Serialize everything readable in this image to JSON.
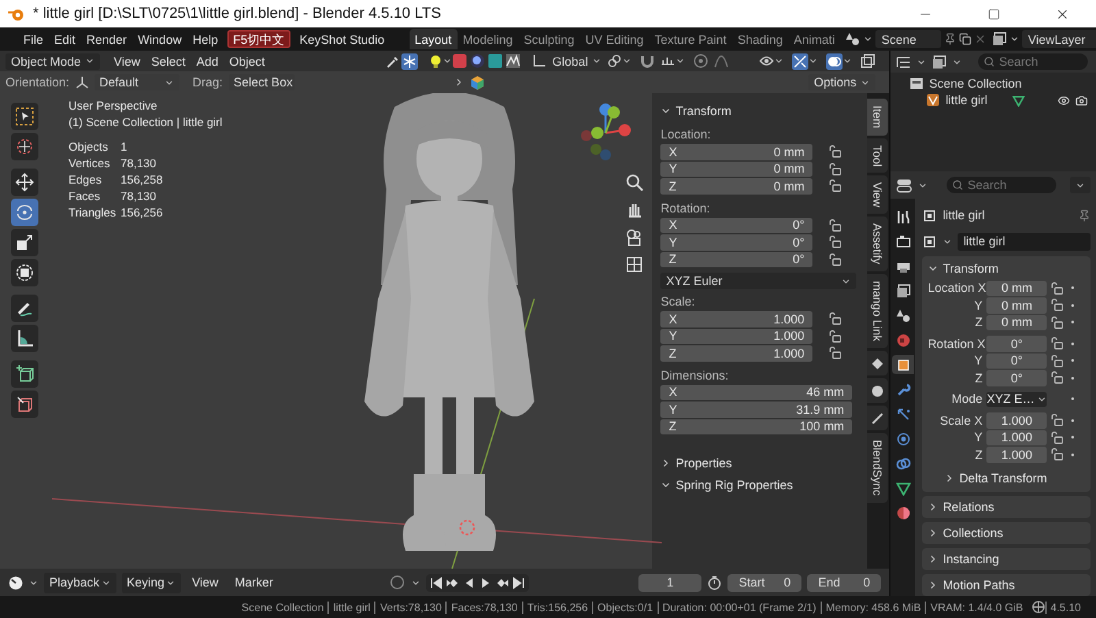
{
  "window": {
    "title": "* little girl [D:\\SLT\\0725\\1\\little girl.blend] - Blender 4.5.10 LTS"
  },
  "menu": [
    "File",
    "Edit",
    "Render",
    "Window",
    "Help"
  ],
  "addon_badge": "F5切中文",
  "addon_menu": "KeyShot Studio",
  "workspaces": [
    {
      "label": "Layout",
      "selected": true
    },
    {
      "label": "Modeling",
      "selected": false
    },
    {
      "label": "Sculpting",
      "selected": false
    },
    {
      "label": "UV Editing",
      "selected": false
    },
    {
      "label": "Texture Paint",
      "selected": false
    },
    {
      "label": "Shading",
      "selected": false
    },
    {
      "label": "Animati",
      "selected": false
    }
  ],
  "scene": "Scene",
  "view_layer": "ViewLayer",
  "viewport": {
    "mode": "Object Mode",
    "menu": [
      "View",
      "Select",
      "Add",
      "Object"
    ],
    "transform_orientation": "Global",
    "orientation_label": "Orientation:",
    "orientation": "Default",
    "drag_label": "Drag:",
    "drag": "Select Box",
    "options": "Options",
    "tools": [
      {
        "kind": "select",
        "selected": false
      },
      {
        "kind": "cursor",
        "selected": false
      },
      {
        "kind": "move",
        "selected": false
      },
      {
        "kind": "rotate",
        "selected": true
      },
      {
        "kind": "scale",
        "selected": false
      },
      {
        "kind": "transform",
        "selected": false
      },
      {
        "kind": "annotate",
        "selected": false
      },
      {
        "kind": "measure",
        "selected": false
      },
      {
        "kind": "add-cube",
        "selected": false
      },
      {
        "kind": "edit-cube",
        "selected": false
      }
    ],
    "view_name": "User Perspective",
    "collection": "(1) Scene Collection | little girl",
    "stats": [
      {
        "label": "Objects",
        "value": "1"
      },
      {
        "label": "Vertices",
        "value": "78,130"
      },
      {
        "label": "Edges",
        "value": "156,258"
      },
      {
        "label": "Faces",
        "value": "78,130"
      },
      {
        "label": "Triangles",
        "value": "156,256"
      }
    ]
  },
  "sidebar": {
    "tabs": [
      {
        "label": "Item",
        "selected": true
      },
      {
        "label": "Tool",
        "selected": false
      },
      {
        "label": "View",
        "selected": false
      },
      {
        "label": "Assetify",
        "selected": false
      },
      {
        "label": "mango Link",
        "selected": false
      },
      {
        "label": "BlendSync",
        "selected": false
      }
    ],
    "transform": {
      "title": "Transform",
      "expanded": true,
      "groups": [
        {
          "label": "Location:",
          "lockable": true,
          "fields": [
            {
              "axis": "X",
              "value": "0 mm"
            },
            {
              "axis": "Y",
              "value": "0 mm"
            },
            {
              "axis": "Z",
              "value": "0 mm"
            }
          ]
        },
        {
          "label": "Rotation:",
          "lockable": true,
          "fields": [
            {
              "axis": "X",
              "value": "0°"
            },
            {
              "axis": "Y",
              "value": "0°"
            },
            {
              "axis": "Z",
              "value": "0°"
            }
          ],
          "mode": "XYZ Euler"
        },
        {
          "label": "Scale:",
          "lockable": true,
          "fields": [
            {
              "axis": "X",
              "value": "1.000"
            },
            {
              "axis": "Y",
              "value": "1.000"
            },
            {
              "axis": "Z",
              "value": "1.000"
            }
          ]
        },
        {
          "label": "Dimensions:",
          "lockable": false,
          "fields": [
            {
              "axis": "X",
              "value": "46 mm"
            },
            {
              "axis": "Y",
              "value": "31.9 mm"
            },
            {
              "axis": "Z",
              "value": "100 mm"
            }
          ]
        }
      ]
    },
    "panels": [
      {
        "title": "Properties",
        "expanded": false
      },
      {
        "title": "Spring Rig Properties",
        "expanded": true
      }
    ]
  },
  "outliner": {
    "search_placeholder": "Search",
    "root": "Scene Collection",
    "items": [
      {
        "label": "little girl"
      }
    ]
  },
  "properties": {
    "search_placeholder": "Search",
    "tabs": [
      {
        "selected": false
      },
      {
        "selected": false
      },
      {
        "selected": false
      },
      {
        "selected": false
      },
      {
        "selected": false
      },
      {
        "selected": false
      },
      {
        "selected": true
      },
      {
        "selected": false
      },
      {
        "selected": false
      },
      {
        "selected": false
      },
      {
        "selected": false
      },
      {
        "selected": false
      },
      {
        "selected": false
      }
    ],
    "object_name": "little girl",
    "data_name": "little girl",
    "transform": {
      "title": "Transform",
      "expanded": true,
      "groups": [
        {
          "rows": [
            {
              "kind": "field",
              "label": "Location X",
              "value": "0 mm"
            },
            {
              "kind": "field",
              "label": "Y",
              "value": "0 mm"
            },
            {
              "kind": "field",
              "label": "Z",
              "value": "0 mm"
            }
          ]
        },
        {
          "rows": [
            {
              "kind": "field",
              "label": "Rotation X",
              "value": "0°"
            },
            {
              "kind": "field",
              "label": "Y",
              "value": "0°"
            },
            {
              "kind": "field",
              "label": "Z",
              "value": "0°"
            }
          ]
        },
        {
          "rows": [
            {
              "kind": "dropdown",
              "label": "Mode",
              "value": "XYZ E…"
            }
          ]
        },
        {
          "rows": [
            {
              "kind": "field",
              "label": "Scale X",
              "value": "1.000"
            },
            {
              "kind": "field",
              "label": "Y",
              "value": "1.000"
            },
            {
              "kind": "field",
              "label": "Z",
              "value": "1.000"
            }
          ]
        }
      ],
      "subpanel": {
        "title": "Delta Transform",
        "expanded": false
      }
    },
    "panels": [
      {
        "title": "Relations",
        "expanded": false
      },
      {
        "title": "Collections",
        "expanded": false
      },
      {
        "title": "Instancing",
        "expanded": false
      },
      {
        "title": "Motion Paths",
        "expanded": false
      }
    ]
  },
  "timeline": {
    "menus": [
      {
        "label": "Playback",
        "dropdown": true
      },
      {
        "label": "Keying",
        "dropdown": true
      },
      {
        "label": "View",
        "dropdown": false
      },
      {
        "label": "Marker",
        "dropdown": false
      }
    ],
    "frame": "1",
    "start_label": "Start",
    "start": "0",
    "end_label": "End",
    "end": "0"
  },
  "status_bar": [
    "Scene Collection",
    "little girl",
    "Verts:78,130",
    "Faces:78,130",
    "Tris:156,256",
    "Objects:0/1",
    "Duration: 00:00+01 (Frame 2/1)",
    "Memory: 458.6 MiB",
    "VRAM: 1.4/4.0 GiB",
    "4.5.10"
  ]
}
